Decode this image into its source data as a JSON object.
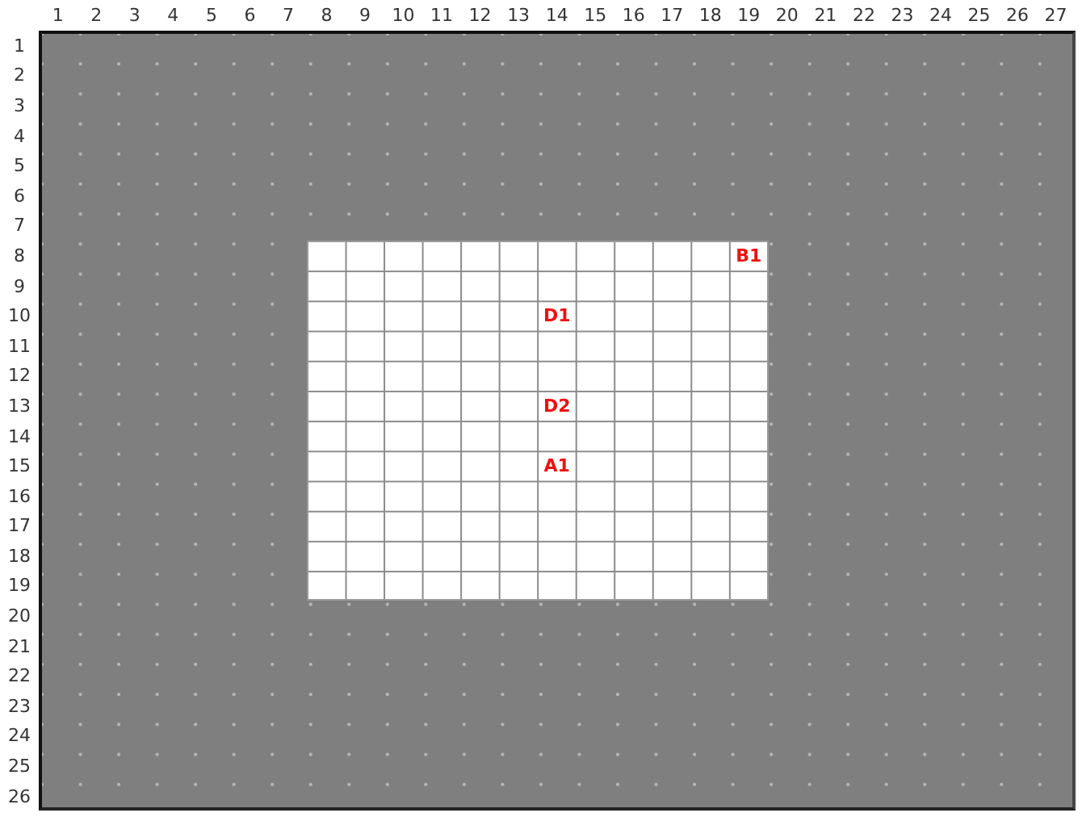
{
  "column_headers": [
    "1",
    "2",
    "3",
    "4",
    "5",
    "6",
    "7",
    "8",
    "9",
    "10",
    "11",
    "12",
    "13",
    "14",
    "15",
    "16",
    "17",
    "18",
    "19",
    "20",
    "21",
    "22",
    "23",
    "24",
    "25",
    "26",
    "27"
  ],
  "row_headers": [
    "1",
    "2",
    "3",
    "4",
    "5",
    "6",
    "7",
    "8",
    "9",
    "10",
    "11",
    "12",
    "13",
    "14",
    "15",
    "16",
    "17",
    "18",
    "19",
    "20",
    "21",
    "22",
    "23",
    "24",
    "25",
    "26"
  ],
  "markers": [
    {
      "label": "B1"
    },
    {
      "label": "D1"
    },
    {
      "label": "D2"
    },
    {
      "label": "A1"
    }
  ]
}
